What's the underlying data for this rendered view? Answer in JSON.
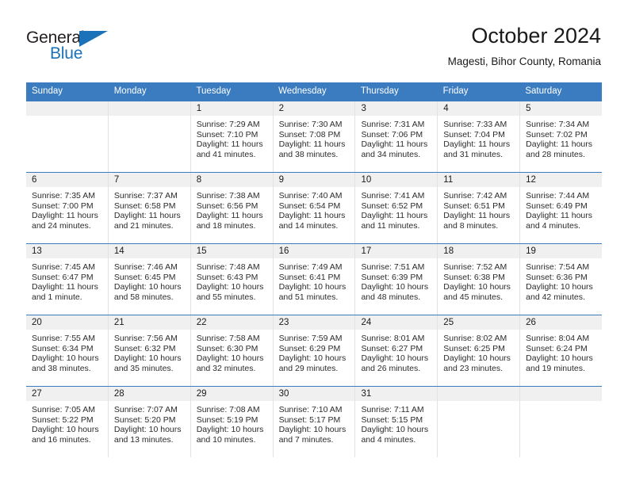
{
  "brand": {
    "name_part1": "General",
    "name_part2": "Blue",
    "triangle_color": "#1b72b8"
  },
  "header": {
    "title": "October 2024",
    "subtitle": "Magesti, Bihor County, Romania"
  },
  "colors": {
    "header_blue": "#3b7cc0",
    "day_band_gray": "#f0f0f0",
    "cell_border": "#e2e2e2",
    "text": "#2b2b2b"
  },
  "weekday_headers": [
    "Sunday",
    "Monday",
    "Tuesday",
    "Wednesday",
    "Thursday",
    "Friday",
    "Saturday"
  ],
  "weeks": [
    [
      {
        "day": "",
        "lines": []
      },
      {
        "day": "",
        "lines": []
      },
      {
        "day": "1",
        "lines": [
          "Sunrise: 7:29 AM",
          "Sunset: 7:10 PM",
          "Daylight: 11 hours",
          "and 41 minutes."
        ]
      },
      {
        "day": "2",
        "lines": [
          "Sunrise: 7:30 AM",
          "Sunset: 7:08 PM",
          "Daylight: 11 hours",
          "and 38 minutes."
        ]
      },
      {
        "day": "3",
        "lines": [
          "Sunrise: 7:31 AM",
          "Sunset: 7:06 PM",
          "Daylight: 11 hours",
          "and 34 minutes."
        ]
      },
      {
        "day": "4",
        "lines": [
          "Sunrise: 7:33 AM",
          "Sunset: 7:04 PM",
          "Daylight: 11 hours",
          "and 31 minutes."
        ]
      },
      {
        "day": "5",
        "lines": [
          "Sunrise: 7:34 AM",
          "Sunset: 7:02 PM",
          "Daylight: 11 hours",
          "and 28 minutes."
        ]
      }
    ],
    [
      {
        "day": "6",
        "lines": [
          "Sunrise: 7:35 AM",
          "Sunset: 7:00 PM",
          "Daylight: 11 hours",
          "and 24 minutes."
        ]
      },
      {
        "day": "7",
        "lines": [
          "Sunrise: 7:37 AM",
          "Sunset: 6:58 PM",
          "Daylight: 11 hours",
          "and 21 minutes."
        ]
      },
      {
        "day": "8",
        "lines": [
          "Sunrise: 7:38 AM",
          "Sunset: 6:56 PM",
          "Daylight: 11 hours",
          "and 18 minutes."
        ]
      },
      {
        "day": "9",
        "lines": [
          "Sunrise: 7:40 AM",
          "Sunset: 6:54 PM",
          "Daylight: 11 hours",
          "and 14 minutes."
        ]
      },
      {
        "day": "10",
        "lines": [
          "Sunrise: 7:41 AM",
          "Sunset: 6:52 PM",
          "Daylight: 11 hours",
          "and 11 minutes."
        ]
      },
      {
        "day": "11",
        "lines": [
          "Sunrise: 7:42 AM",
          "Sunset: 6:51 PM",
          "Daylight: 11 hours",
          "and 8 minutes."
        ]
      },
      {
        "day": "12",
        "lines": [
          "Sunrise: 7:44 AM",
          "Sunset: 6:49 PM",
          "Daylight: 11 hours",
          "and 4 minutes."
        ]
      }
    ],
    [
      {
        "day": "13",
        "lines": [
          "Sunrise: 7:45 AM",
          "Sunset: 6:47 PM",
          "Daylight: 11 hours",
          "and 1 minute."
        ]
      },
      {
        "day": "14",
        "lines": [
          "Sunrise: 7:46 AM",
          "Sunset: 6:45 PM",
          "Daylight: 10 hours",
          "and 58 minutes."
        ]
      },
      {
        "day": "15",
        "lines": [
          "Sunrise: 7:48 AM",
          "Sunset: 6:43 PM",
          "Daylight: 10 hours",
          "and 55 minutes."
        ]
      },
      {
        "day": "16",
        "lines": [
          "Sunrise: 7:49 AM",
          "Sunset: 6:41 PM",
          "Daylight: 10 hours",
          "and 51 minutes."
        ]
      },
      {
        "day": "17",
        "lines": [
          "Sunrise: 7:51 AM",
          "Sunset: 6:39 PM",
          "Daylight: 10 hours",
          "and 48 minutes."
        ]
      },
      {
        "day": "18",
        "lines": [
          "Sunrise: 7:52 AM",
          "Sunset: 6:38 PM",
          "Daylight: 10 hours",
          "and 45 minutes."
        ]
      },
      {
        "day": "19",
        "lines": [
          "Sunrise: 7:54 AM",
          "Sunset: 6:36 PM",
          "Daylight: 10 hours",
          "and 42 minutes."
        ]
      }
    ],
    [
      {
        "day": "20",
        "lines": [
          "Sunrise: 7:55 AM",
          "Sunset: 6:34 PM",
          "Daylight: 10 hours",
          "and 38 minutes."
        ]
      },
      {
        "day": "21",
        "lines": [
          "Sunrise: 7:56 AM",
          "Sunset: 6:32 PM",
          "Daylight: 10 hours",
          "and 35 minutes."
        ]
      },
      {
        "day": "22",
        "lines": [
          "Sunrise: 7:58 AM",
          "Sunset: 6:30 PM",
          "Daylight: 10 hours",
          "and 32 minutes."
        ]
      },
      {
        "day": "23",
        "lines": [
          "Sunrise: 7:59 AM",
          "Sunset: 6:29 PM",
          "Daylight: 10 hours",
          "and 29 minutes."
        ]
      },
      {
        "day": "24",
        "lines": [
          "Sunrise: 8:01 AM",
          "Sunset: 6:27 PM",
          "Daylight: 10 hours",
          "and 26 minutes."
        ]
      },
      {
        "day": "25",
        "lines": [
          "Sunrise: 8:02 AM",
          "Sunset: 6:25 PM",
          "Daylight: 10 hours",
          "and 23 minutes."
        ]
      },
      {
        "day": "26",
        "lines": [
          "Sunrise: 8:04 AM",
          "Sunset: 6:24 PM",
          "Daylight: 10 hours",
          "and 19 minutes."
        ]
      }
    ],
    [
      {
        "day": "27",
        "lines": [
          "Sunrise: 7:05 AM",
          "Sunset: 5:22 PM",
          "Daylight: 10 hours",
          "and 16 minutes."
        ]
      },
      {
        "day": "28",
        "lines": [
          "Sunrise: 7:07 AM",
          "Sunset: 5:20 PM",
          "Daylight: 10 hours",
          "and 13 minutes."
        ]
      },
      {
        "day": "29",
        "lines": [
          "Sunrise: 7:08 AM",
          "Sunset: 5:19 PM",
          "Daylight: 10 hours",
          "and 10 minutes."
        ]
      },
      {
        "day": "30",
        "lines": [
          "Sunrise: 7:10 AM",
          "Sunset: 5:17 PM",
          "Daylight: 10 hours",
          "and 7 minutes."
        ]
      },
      {
        "day": "31",
        "lines": [
          "Sunrise: 7:11 AM",
          "Sunset: 5:15 PM",
          "Daylight: 10 hours",
          "and 4 minutes."
        ]
      },
      {
        "day": "",
        "lines": []
      },
      {
        "day": "",
        "lines": []
      }
    ]
  ]
}
